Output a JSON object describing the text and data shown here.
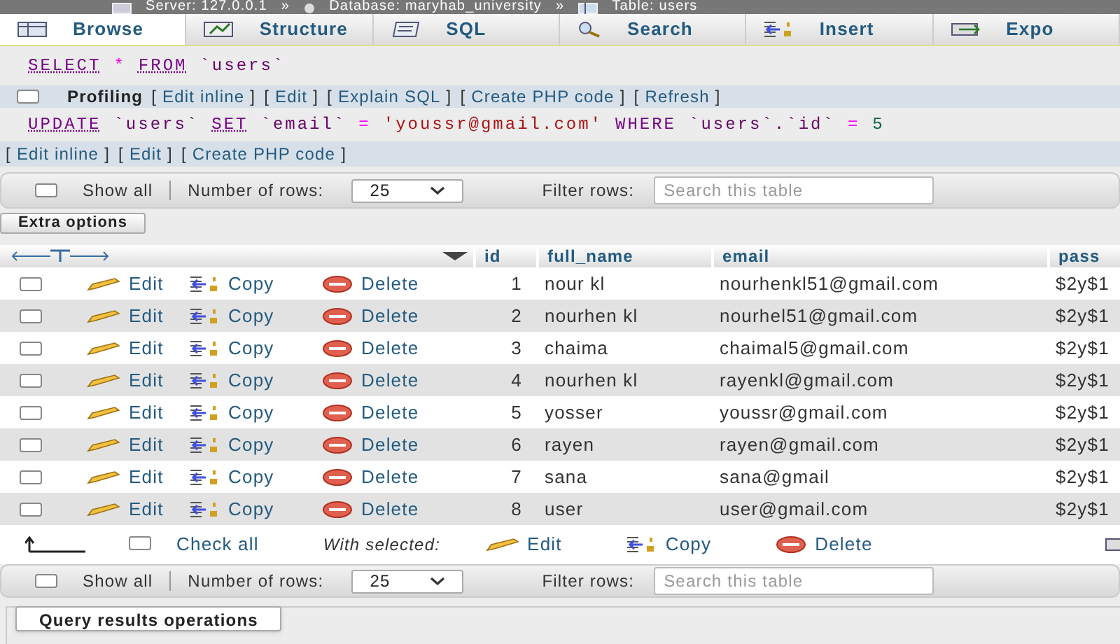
{
  "breadcrumb": [
    {
      "kind": "server",
      "text": "Server: 127.0.0.1"
    },
    {
      "kind": "database",
      "text": "Database: maryhab_university"
    },
    {
      "kind": "table",
      "text": "Table: users"
    }
  ],
  "breadcrumb_separator": "»",
  "tabs": [
    {
      "kind": "browse",
      "label": "Browse",
      "selected": true
    },
    {
      "kind": "structure",
      "label": "Structure",
      "selected": false
    },
    {
      "kind": "sql",
      "label": "SQL",
      "selected": false
    },
    {
      "kind": "search",
      "label": "Search",
      "selected": false
    },
    {
      "kind": "insert",
      "label": "Insert",
      "selected": false
    },
    {
      "kind": "export",
      "label": "Expo",
      "selected": false
    }
  ],
  "select_query": [
    {
      "kind": "keyword",
      "text": "SELECT"
    },
    {
      "kind": "op",
      "text": "*"
    },
    {
      "kind": "keyword",
      "text": "FROM"
    },
    {
      "kind": "ident",
      "text": "`users`"
    }
  ],
  "profiling": {
    "label": "Profiling",
    "checked": false,
    "links": [
      {
        "open": "[",
        "label": "Edit inline",
        "close": "]"
      },
      {
        "open": "[",
        "label": "Edit",
        "close": "]"
      },
      {
        "open": "[",
        "label": "Explain SQL",
        "close": "]"
      },
      {
        "open": "[",
        "label": "Create PHP code",
        "close": "]"
      },
      {
        "open": "[",
        "label": "Refresh",
        "close": "]"
      }
    ]
  },
  "update_query": [
    {
      "kind": "keyword",
      "text": "UPDATE"
    },
    {
      "kind": "ident",
      "text": "`users`"
    },
    {
      "kind": "keyword",
      "text": "SET"
    },
    {
      "kind": "ident",
      "text": "`email`"
    },
    {
      "kind": "op",
      "text": "="
    },
    {
      "kind": "string",
      "text": "'youssr@gmail.com'"
    },
    {
      "kind": "plainkw",
      "text": "WHERE"
    },
    {
      "kind": "ident",
      "text": "`users`.`id`"
    },
    {
      "kind": "op",
      "text": "="
    },
    {
      "kind": "number",
      "text": "5"
    }
  ],
  "update_links": [
    {
      "open": "[",
      "label": "Edit inline",
      "close": "]"
    },
    {
      "open": "[",
      "label": "Edit",
      "close": "]"
    },
    {
      "open": "[",
      "label": "Create PHP code",
      "close": "]"
    }
  ],
  "nav_top": {
    "show_all": {
      "label": "Show all",
      "checked": false
    },
    "rows_label": "Number of rows:",
    "rows_value": "25",
    "filter_label": "Filter rows:",
    "filter_placeholder": "Search this table"
  },
  "extra_options": "Extra options",
  "columns": [
    "id",
    "full_name",
    "email",
    "pass"
  ],
  "rows": [
    {
      "checked": false,
      "actions": [
        {
          "kind": "edit",
          "label": "Edit"
        },
        {
          "kind": "copy",
          "label": "Copy"
        },
        {
          "kind": "delete",
          "label": "Delete"
        }
      ],
      "cells": [
        "1",
        "nour kl",
        "nourhenkl51@gmail.com",
        "$2y$1"
      ]
    },
    {
      "checked": false,
      "actions": [
        {
          "kind": "edit",
          "label": "Edit"
        },
        {
          "kind": "copy",
          "label": "Copy"
        },
        {
          "kind": "delete",
          "label": "Delete"
        }
      ],
      "cells": [
        "2",
        "nourhen kl",
        "nourhel51@gmail.com",
        "$2y$1"
      ]
    },
    {
      "checked": false,
      "actions": [
        {
          "kind": "edit",
          "label": "Edit"
        },
        {
          "kind": "copy",
          "label": "Copy"
        },
        {
          "kind": "delete",
          "label": "Delete"
        }
      ],
      "cells": [
        "3",
        "chaima",
        "chaimal5@gmail.com",
        "$2y$1"
      ]
    },
    {
      "checked": false,
      "actions": [
        {
          "kind": "edit",
          "label": "Edit"
        },
        {
          "kind": "copy",
          "label": "Copy"
        },
        {
          "kind": "delete",
          "label": "Delete"
        }
      ],
      "cells": [
        "4",
        "nourhen kl",
        "rayenkl@gmail.com",
        "$2y$1"
      ]
    },
    {
      "checked": false,
      "actions": [
        {
          "kind": "edit",
          "label": "Edit"
        },
        {
          "kind": "copy",
          "label": "Copy"
        },
        {
          "kind": "delete",
          "label": "Delete"
        }
      ],
      "cells": [
        "5",
        "yosser",
        "youssr@gmail.com",
        "$2y$1"
      ]
    },
    {
      "checked": false,
      "actions": [
        {
          "kind": "edit",
          "label": "Edit"
        },
        {
          "kind": "copy",
          "label": "Copy"
        },
        {
          "kind": "delete",
          "label": "Delete"
        }
      ],
      "cells": [
        "6",
        "rayen",
        "rayen@gmail.com",
        "$2y$1"
      ]
    },
    {
      "checked": false,
      "actions": [
        {
          "kind": "edit",
          "label": "Edit"
        },
        {
          "kind": "copy",
          "label": "Copy"
        },
        {
          "kind": "delete",
          "label": "Delete"
        }
      ],
      "cells": [
        "7",
        "sana",
        "sana@gmail",
        "$2y$1"
      ]
    },
    {
      "checked": false,
      "actions": [
        {
          "kind": "edit",
          "label": "Edit"
        },
        {
          "kind": "copy",
          "label": "Copy"
        },
        {
          "kind": "delete",
          "label": "Delete"
        }
      ],
      "cells": [
        "8",
        "user",
        "user@gmail.com",
        "$2y$1"
      ]
    }
  ],
  "bulk": {
    "check_all": {
      "label": "Check all",
      "checked": false
    },
    "with_selected": "With selected:",
    "actions": [
      {
        "kind": "edit",
        "label": "Edit"
      },
      {
        "kind": "copy",
        "label": "Copy"
      },
      {
        "kind": "delete",
        "label": "Delete"
      }
    ]
  },
  "nav_bottom": {
    "show_all": {
      "label": "Show all",
      "checked": false
    },
    "rows_label": "Number of rows:",
    "rows_value": "25",
    "filter_label": "Filter rows:",
    "filter_placeholder": "Search this table"
  },
  "query_results_operations": "Query results operations"
}
